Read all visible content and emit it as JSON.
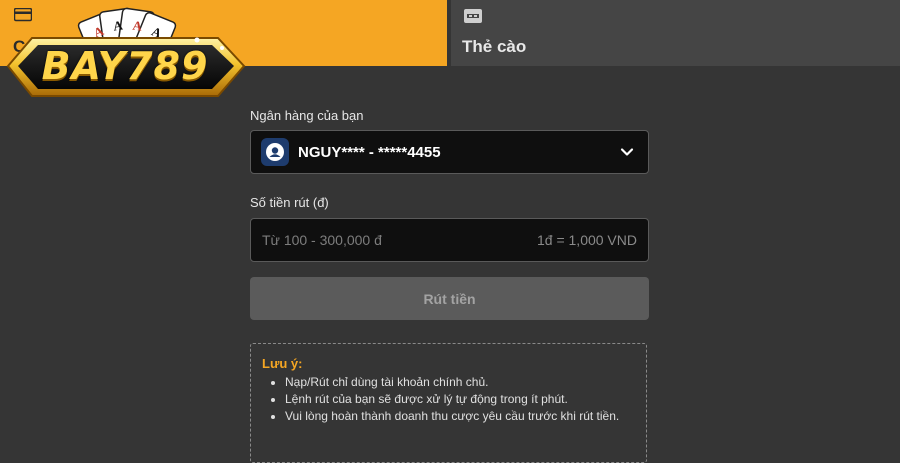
{
  "tabs": {
    "bank": {
      "label": "C",
      "icon": "card-icon",
      "active": true
    },
    "card": {
      "label": "Thẻ cào",
      "icon": "scratch-card-icon",
      "active": false
    }
  },
  "logo": {
    "text": "BAY789"
  },
  "form": {
    "bank_label": "Ngân hàng của bạn",
    "bank_selected": "NGUY**** - *****4455",
    "amount_label": "Số tiền rút (đ)",
    "amount_placeholder": "Từ 100 - 300,000 đ",
    "amount_value": "",
    "rate": "1đ = 1,000 VND",
    "submit_label": "Rút tiền"
  },
  "note": {
    "title": "Lưu ý:",
    "items": [
      "Nạp/Rút chỉ dùng tài khoản chính chủ.",
      "Lệnh rút của bạn sẽ được xử lý tự động trong ít phút.",
      "Vui lòng hoàn thành doanh thu cược yêu cầu trước khi rút tiền."
    ]
  },
  "colors": {
    "accent": "#f5a623",
    "background": "#353535",
    "input_bg": "#0f0f0f",
    "button_disabled": "#5b5b5b"
  }
}
